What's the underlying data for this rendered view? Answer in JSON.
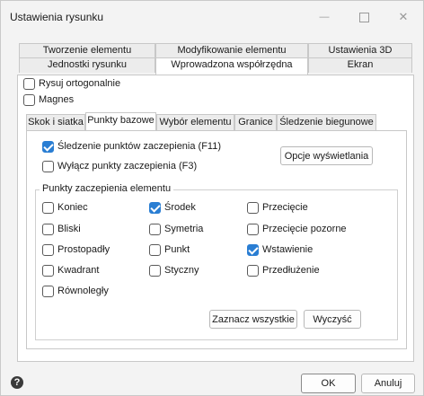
{
  "window": {
    "title": "Ustawienia rysunku",
    "minimize_glyph": "—",
    "maximize_glyph": "☐",
    "close_glyph": "✕"
  },
  "top_tabs": {
    "row1": [
      "Tworzenie elementu",
      "Modyfikowanie elementu",
      "Ustawienia 3D"
    ],
    "row2": [
      "Jednostki rysunku",
      "Wprowadzona współrzędna",
      "Ekran"
    ],
    "active": "Wprowadzona współrzędna"
  },
  "options": {
    "ortho_label": "Rysuj ortogonalnie",
    "ortho_checked": false,
    "magnet_label": "Magnes",
    "magnet_checked": false
  },
  "inner_tabs": {
    "items": [
      "Skok i siatka",
      "Punkty bazowe",
      "Wybór elementu",
      "Granice",
      "Śledzenie biegunowe"
    ],
    "active": "Punkty bazowe"
  },
  "snap": {
    "tracking_label": "Śledzenie punktów zaczepienia (F11)",
    "tracking_checked": true,
    "disable_label": "Wyłącz punkty zaczepienia (F3)",
    "disable_checked": false,
    "display_options_button": "Opcje wyświetlania",
    "group_title": "Punkty zaczepienia elementu",
    "points": [
      {
        "label": "Koniec",
        "checked": false
      },
      {
        "label": "Środek",
        "checked": true
      },
      {
        "label": "Przecięcie",
        "checked": false
      },
      {
        "label": "Bliski",
        "checked": false
      },
      {
        "label": "Symetria",
        "checked": false
      },
      {
        "label": "Przecięcie pozorne",
        "checked": false
      },
      {
        "label": "Prostopadły",
        "checked": false
      },
      {
        "label": "Punkt",
        "checked": false
      },
      {
        "label": "Wstawienie",
        "checked": true
      },
      {
        "label": "Kwadrant",
        "checked": false
      },
      {
        "label": "Styczny",
        "checked": false
      },
      {
        "label": "Przedłużenie",
        "checked": false
      },
      {
        "label": "Równoległy",
        "checked": false
      }
    ],
    "select_all_button": "Zaznacz wszystkie",
    "clear_button": "Wyczyść"
  },
  "footer": {
    "help_glyph": "?",
    "ok_button": "OK",
    "cancel_button": "Anuluj"
  },
  "colors": {
    "accent": "#2a7ed3",
    "window_bg": "#f3f3f3",
    "panel_bg": "#ffffff"
  }
}
